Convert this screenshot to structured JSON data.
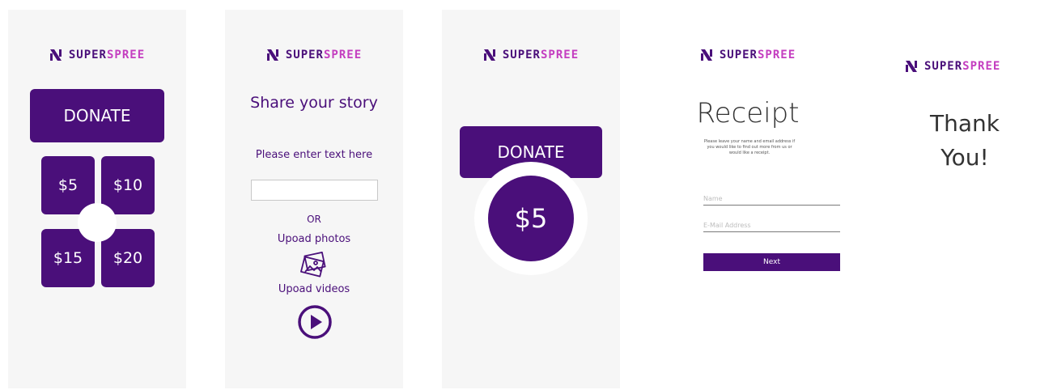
{
  "brand": {
    "name_part1": "SUPER",
    "name_part2": "SPREE",
    "icon": "superspree-logo-icon",
    "primary_color": "#4a0f7a",
    "accent_color": "#c43ec0"
  },
  "screen1": {
    "donate_label": "DONATE",
    "amounts": [
      "$5",
      "$10",
      "$15",
      "$20"
    ]
  },
  "screen2": {
    "title": "Share your story",
    "prompt": "Please enter text here",
    "or_label": "OR",
    "photos_label": "Upoad photos",
    "videos_label": "Upoad videos",
    "photo_icon": "photos-icon",
    "play_icon": "play-icon"
  },
  "screen3": {
    "donate_label": "DONATE",
    "selected_amount": "$5"
  },
  "screen4": {
    "title": "Receipt",
    "message": "Please leave your name and email address if you would like to find out more from us or would like a receipt.",
    "name_placeholder": "Name",
    "email_placeholder": "E-Mail Address",
    "next_label": "Next"
  },
  "screen5": {
    "line1": "Thank",
    "line2": "You!"
  }
}
